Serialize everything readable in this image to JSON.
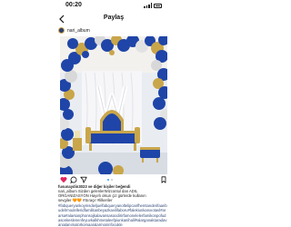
{
  "status_bar": {
    "time": "00:20"
  },
  "header": {
    "title": "Paylaş"
  },
  "post": {
    "username": "nari_album",
    "likes_text": "fusunaydin3023 ve diğer kişiler beğendi",
    "caption_lines": [
      "nari_album Sizden gelenlerWizcontul dan ADIL",
      "ORGANIZASYON Hayırlı olsun çiz gürlerde kullanın",
      "sevgiler 🧡🧡 #Sıraçır #lilkeriler"
    ],
    "hashtags": "#fabqueryankoymsdieljuelfabqueryanoltelipcanfhemtanderifaanbudelrmodelleridfamilitanbeyazkavilifaboru#falekiunkanxıotavl#ararsa#alarsanphonsojkalavansasoodirirfamonelelerfamikonpofudasonkeslenenfeyuvkalkhmetaleefpiunkanihalil#alarganaktaradavanialanımalorkomaaralarmoninfocukle"
  },
  "colors": {
    "royal_blue": "#1f45a8",
    "gold": "#c9a64a",
    "chrome": "#d8d8d8",
    "link": "#3897f0"
  },
  "icons": [
    "chevron-left-icon",
    "heart-icon",
    "comment-icon",
    "share-icon",
    "bookmark-icon"
  ]
}
